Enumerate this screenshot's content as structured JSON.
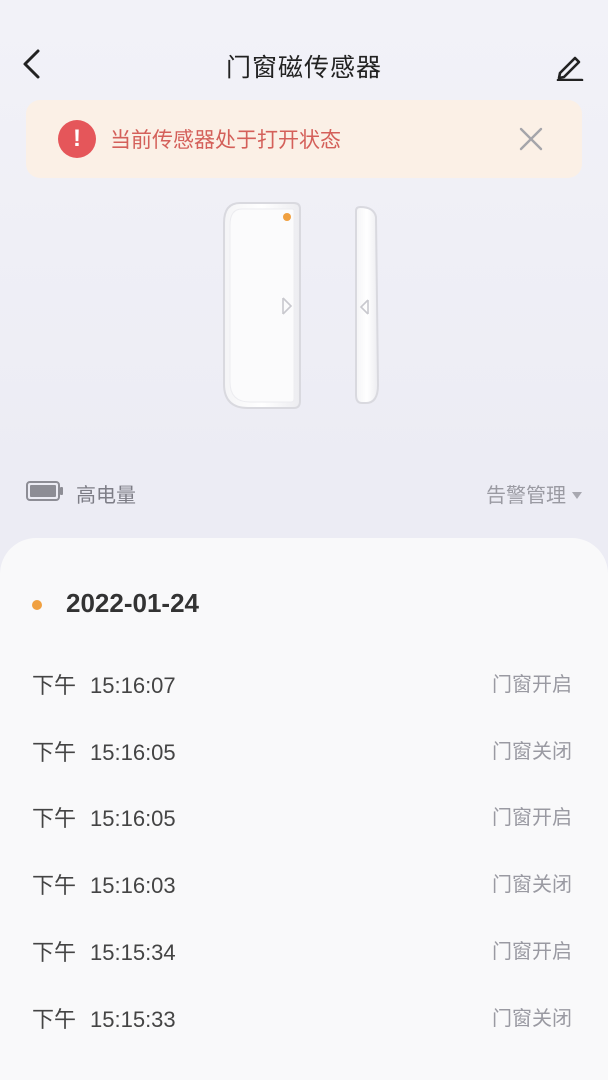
{
  "header": {
    "title": "门窗磁传感器",
    "back_icon": "chevron-left-icon",
    "edit_icon": "pencil-icon"
  },
  "alert": {
    "text": "当前传感器处于打开状态",
    "icon": "exclamation-circle-icon",
    "close_icon": "close-icon",
    "colors": {
      "background": "#fbf0e6",
      "icon": "#e5565a",
      "text": "#d4605a"
    }
  },
  "device": {
    "indicator_color": "#f0a040"
  },
  "status": {
    "battery_icon": "battery-full-icon",
    "battery_label": "高电量",
    "alarm_manage_label": "告警管理"
  },
  "log": {
    "date": "2022-01-24",
    "events": [
      {
        "period": "下午",
        "time": "15:16:07",
        "status": "门窗开启"
      },
      {
        "period": "下午",
        "time": "15:16:05",
        "status": "门窗关闭"
      },
      {
        "period": "下午",
        "time": "15:16:05",
        "status": "门窗开启"
      },
      {
        "period": "下午",
        "time": "15:16:03",
        "status": "门窗关闭"
      },
      {
        "period": "下午",
        "time": "15:15:34",
        "status": "门窗开启"
      },
      {
        "period": "下午",
        "time": "15:15:33",
        "status": "门窗关闭"
      }
    ]
  }
}
